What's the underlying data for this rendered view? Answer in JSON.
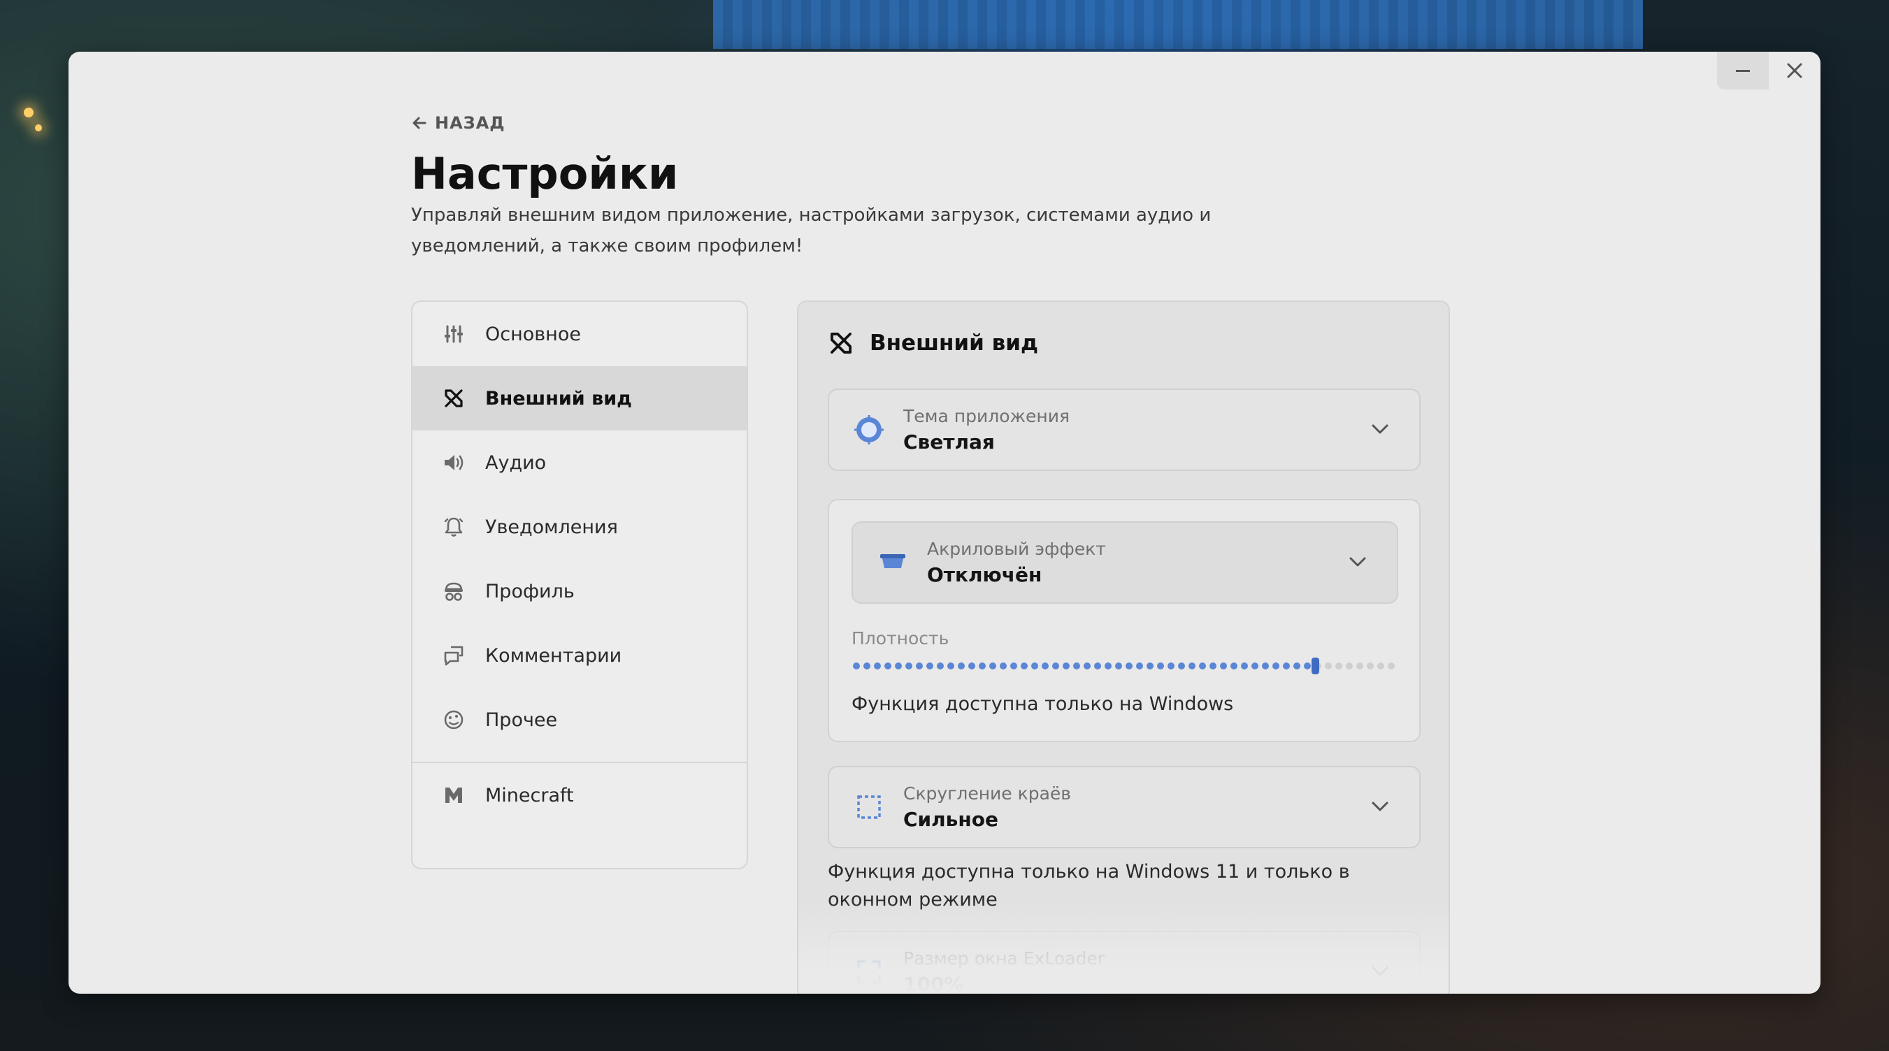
{
  "window": {
    "minimize_symbol": "—",
    "close_symbol": "✕"
  },
  "header": {
    "back_label": "НАЗАД",
    "title": "Настройки",
    "subtitle": "Управляй внешним видом приложение, настройками загрузок, системами аудио и уведомлений, а также своим профилем!"
  },
  "sidebar": {
    "items": [
      {
        "label": "Основное",
        "icon": "sliders-icon"
      },
      {
        "label": "Внешний вид",
        "icon": "paint-tools-icon",
        "active": true
      },
      {
        "label": "Аудио",
        "icon": "speaker-icon"
      },
      {
        "label": "Уведомления",
        "icon": "bell-icon"
      },
      {
        "label": "Профиль",
        "icon": "profile-icon"
      },
      {
        "label": "Комментарии",
        "icon": "comments-icon"
      },
      {
        "label": "Прочее",
        "icon": "misc-icon"
      }
    ],
    "extra_item": {
      "label": "Minecraft",
      "icon": "minecraft-icon"
    }
  },
  "panel": {
    "title": "Внешний вид",
    "theme": {
      "label": "Тема приложения",
      "value": "Светлая"
    },
    "acrylic": {
      "label": "Акриловый эффект",
      "value": "Отключён",
      "density_label": "Плотность",
      "density_value": 0.86,
      "note": "Функция доступна только на Windows"
    },
    "corners": {
      "label": "Скругление краёв",
      "value": "Сильное",
      "note": "Функция доступна только на Windows 11 и только в оконном режиме"
    },
    "window_size": {
      "label": "Размер окна ExLoader",
      "value": "100%"
    }
  },
  "colors": {
    "window_bg": "#ebebeb",
    "accent_blue": "#5b86d6",
    "active_nav_bg": "#d8d8d8"
  }
}
